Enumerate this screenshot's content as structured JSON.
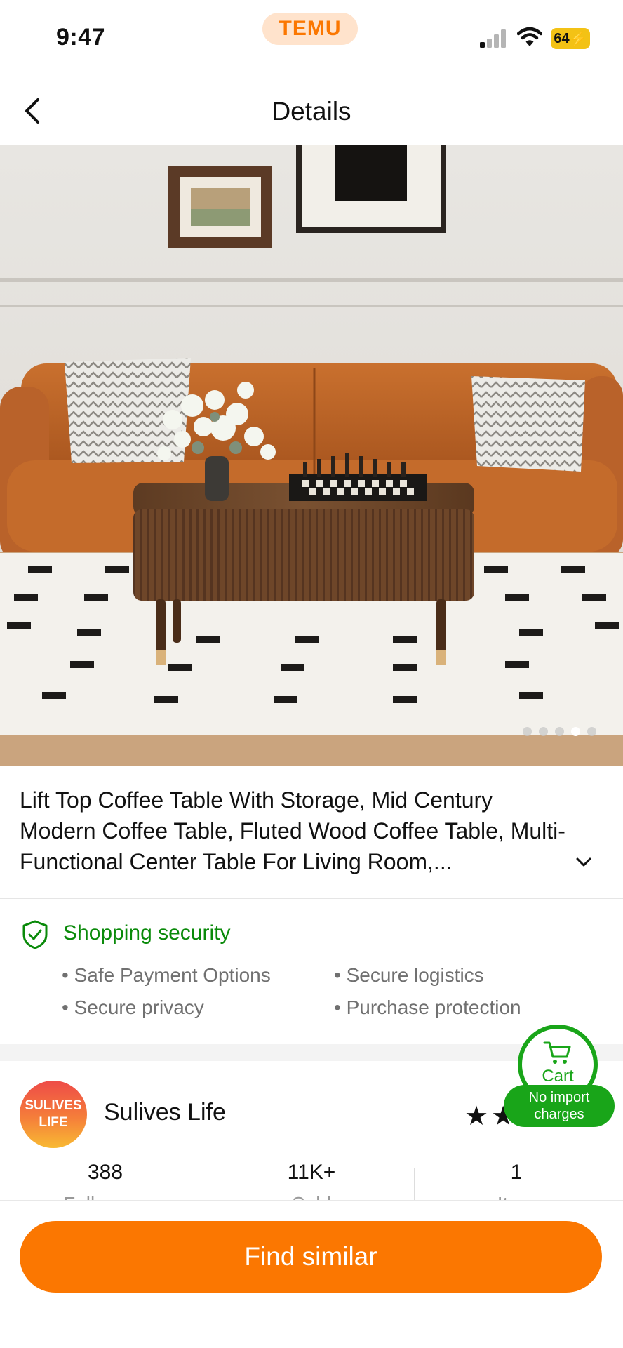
{
  "status_bar": {
    "time": "9:47",
    "app_badge": "TEMU",
    "battery": "64"
  },
  "header": {
    "title": "Details"
  },
  "product": {
    "title": "Lift Top Coffee Table With Storage, Mid Century Modern Coffee Table, Fluted Wood Coffee Table, Multi-Functional Center Table For Living Room,...",
    "image_count": 5,
    "active_image_index": 3
  },
  "security": {
    "title": "Shopping security",
    "items": [
      "Safe Payment Options",
      "Secure logistics",
      "Secure privacy",
      "Purchase protection"
    ]
  },
  "store": {
    "logo_text_line1": "SULIVES",
    "logo_text_line2": "LIFE",
    "name": "Sulives Life",
    "stars": "★★",
    "stats": [
      {
        "value": "388",
        "label": "Followers"
      },
      {
        "value": "11K+",
        "label": "Sold"
      },
      {
        "value": "1",
        "label": "Item"
      }
    ]
  },
  "cart": {
    "label": "Cart",
    "badge_line1": "No import",
    "badge_line2": "charges"
  },
  "actions": {
    "find_similar": "Find similar"
  },
  "colors": {
    "brand_orange": "#fb7701",
    "security_green": "#0a8a0a",
    "cart_green": "#19a519"
  }
}
